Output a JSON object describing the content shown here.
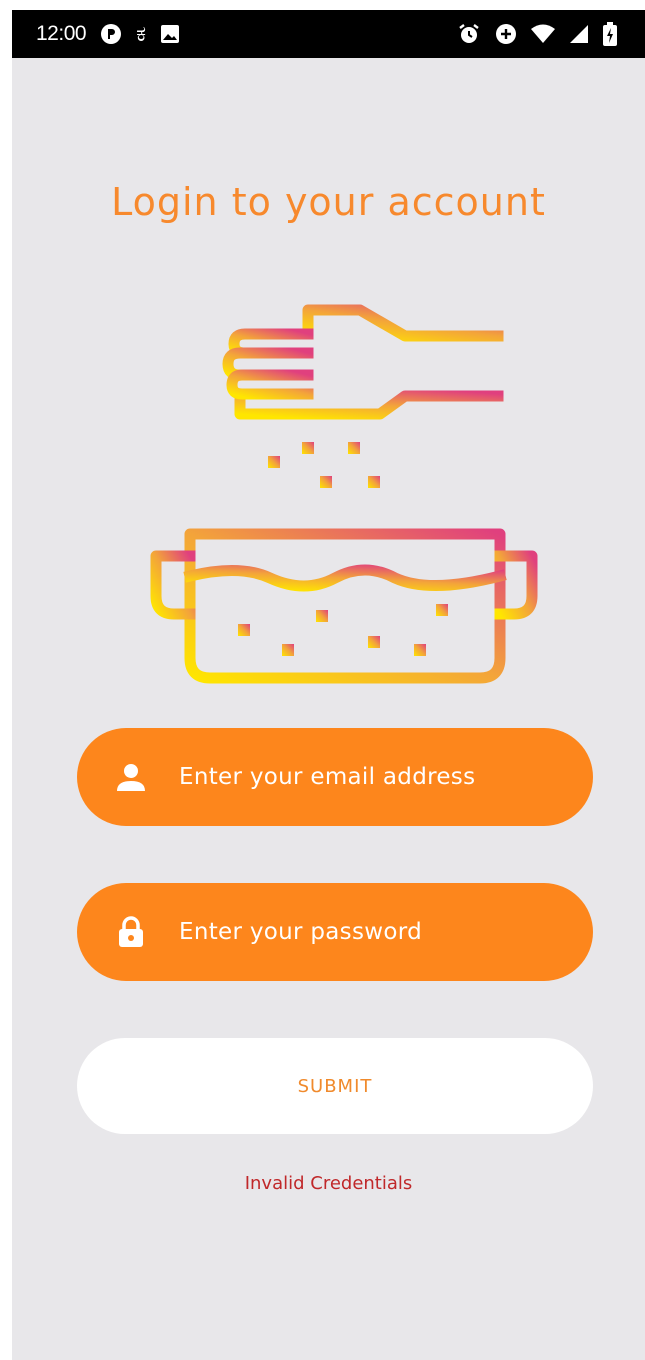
{
  "status_bar": {
    "time": "12:00",
    "left_icons": [
      "app-p-icon",
      "kannada-glyph-icon",
      "image-icon"
    ],
    "kannada_glyph": "ಕ",
    "right_icons": [
      "alarm-icon",
      "data-saver-icon",
      "wifi-icon",
      "signal-icon",
      "battery-charging-icon"
    ]
  },
  "login": {
    "title": "Login to your account",
    "email": {
      "placeholder": "Enter your email address",
      "value": "",
      "icon": "person-icon"
    },
    "password": {
      "placeholder": "Enter your password",
      "value": "",
      "icon": "lock-icon"
    },
    "submit_label": "SUBMIT",
    "error_message": "Invalid Credentials"
  },
  "colors": {
    "accent": "#fd861c",
    "title": "#f7892d",
    "error": "#c0282a",
    "background": "#e8e7ea",
    "gradient_start": "#ffe600",
    "gradient_end": "#e0407e"
  }
}
